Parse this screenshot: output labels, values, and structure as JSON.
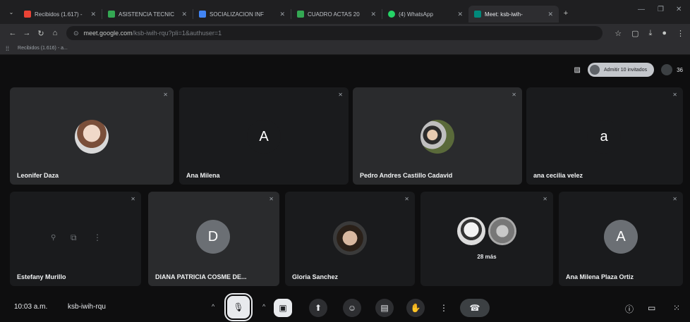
{
  "browser": {
    "tabs": [
      {
        "title": "Recibidos (1.617) -",
        "color": "#ea4335"
      },
      {
        "title": "ASISTENCIA TECNIC",
        "color": "#34a853"
      },
      {
        "title": "SOCIALIZACION INF",
        "color": "#4285f4"
      },
      {
        "title": "CUADRO ACTAS 20",
        "color": "#34a853"
      },
      {
        "title": "(4) WhatsApp",
        "color": "#25d366"
      },
      {
        "title": "Meet: ksb-iwih-",
        "color": "#00897b"
      }
    ],
    "url_host": "meet.google.com",
    "url_path": "/ksb-iwih-rqu?pli=1&authuser=1",
    "bookmark": "Recibidos (1.616) - a..."
  },
  "meet": {
    "admit_label": "Admitir 10 invitados",
    "people_count": "36",
    "participants": [
      {
        "name": "Leonifer Daza",
        "kind": "photo"
      },
      {
        "name": "Ana Milena",
        "kind": "letter",
        "letter": "A"
      },
      {
        "name": "Pedro Andres Castillo Cadavid",
        "kind": "photo"
      },
      {
        "name": "ana cecilia velez",
        "kind": "letter",
        "letter": "a"
      },
      {
        "name": "Estefany Murillo",
        "kind": "none"
      },
      {
        "name": "DIANA PATRICIA COSME DE...",
        "kind": "letter",
        "letter": "D"
      },
      {
        "name": "Gloria Sanchez",
        "kind": "photo"
      },
      {
        "name": "",
        "kind": "more",
        "more_label": "28 más"
      },
      {
        "name": "Ana Milena Plaza Ortiz",
        "kind": "letter",
        "letter": "A"
      }
    ],
    "time": "10:03 a.m.",
    "meeting_code": "ksb-iwih-rqu"
  }
}
